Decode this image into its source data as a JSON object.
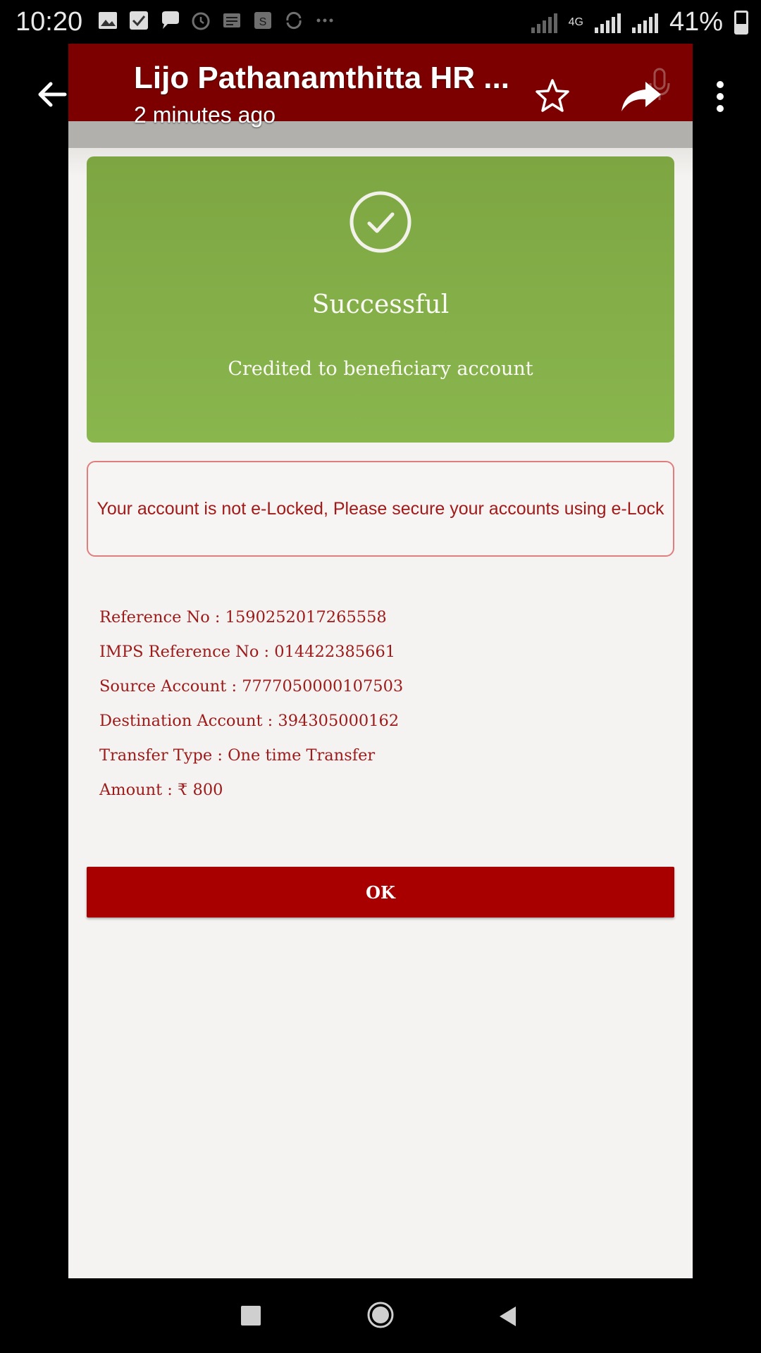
{
  "status_bar": {
    "time": "10:20",
    "battery_percent": "41%",
    "network": "4G",
    "notification_icons": [
      "image-icon",
      "check-box-icon",
      "chat-icon",
      "alarm-icon",
      "message-icon",
      "app-icon",
      "sync-icon",
      "more-dots-icon"
    ]
  },
  "header": {
    "title": "Lijo Pathanamthitta HR ...",
    "subtitle": "2 minutes ago",
    "icons": [
      "back-arrow-icon",
      "star-icon",
      "share-icon",
      "more-vertical-icon"
    ]
  },
  "success_card": {
    "title": "Successful",
    "message": "Credited to beneficiary account",
    "color": "#8ab64e"
  },
  "warning": {
    "text": "Your account is not e-Locked, Please secure your accounts using e-Lock"
  },
  "details": [
    {
      "label": "Reference No",
      "value": "1590252017265558"
    },
    {
      "label": "IMPS Reference No",
      "value": "014422385661"
    },
    {
      "label": "Source Account",
      "value": "7777050000107503"
    },
    {
      "label": "Destination Account",
      "value": "394305000162"
    },
    {
      "label": "Transfer Type",
      "value": "One time Transfer"
    },
    {
      "label": "Amount",
      "value": "₹ 800"
    }
  ],
  "ok_button": {
    "label": "OK",
    "color": "#a80000"
  },
  "colors": {
    "app_bar": "#7d0000",
    "text_primary": "#9c1a1a"
  }
}
